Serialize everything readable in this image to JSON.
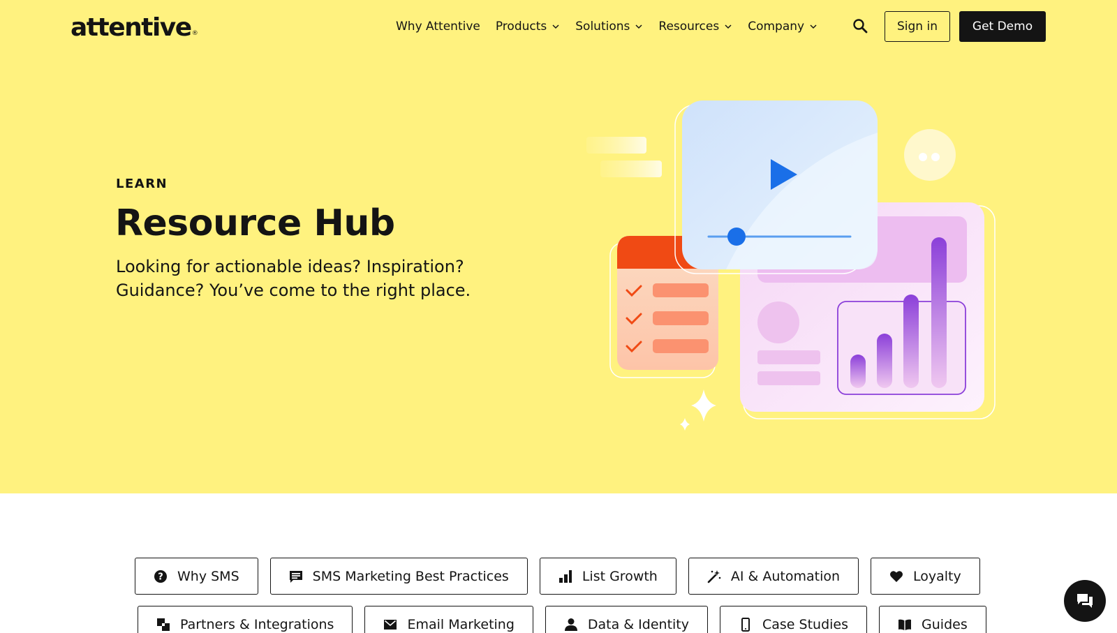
{
  "header": {
    "logo": "attentive",
    "logo_mark": "®",
    "nav": [
      {
        "label": "Why Attentive",
        "dropdown": false
      },
      {
        "label": "Products",
        "dropdown": true
      },
      {
        "label": "Solutions",
        "dropdown": true
      },
      {
        "label": "Resources",
        "dropdown": true
      },
      {
        "label": "Company",
        "dropdown": true
      }
    ],
    "search_icon": "search-icon",
    "signin_label": "Sign in",
    "demo_label": "Get Demo"
  },
  "hero": {
    "eyebrow": "LEARN",
    "title": "Resource Hub",
    "subtitle_line1": "Looking for actionable ideas? Inspiration?",
    "subtitle_line2": "Guidance? You’ve come to the right place."
  },
  "categories": {
    "row1": [
      {
        "label": "Why SMS",
        "icon": "question-circle-icon"
      },
      {
        "label": "SMS Marketing Best Practices",
        "icon": "message-icon"
      },
      {
        "label": "List Growth",
        "icon": "bar-chart-icon"
      },
      {
        "label": "AI & Automation",
        "icon": "magic-wand-icon"
      },
      {
        "label": "Loyalty",
        "icon": "heart-icon"
      }
    ],
    "row2": [
      {
        "label": "Partners & Integrations",
        "icon": "partners-icon"
      },
      {
        "label": "Email Marketing",
        "icon": "envelope-icon"
      },
      {
        "label": "Data & Identity",
        "icon": "person-icon"
      },
      {
        "label": "Case Studies",
        "icon": "phone-icon"
      },
      {
        "label": "Guides",
        "icon": "book-icon"
      }
    ]
  },
  "colors": {
    "hero_bg": "#fff27f",
    "text": "#141414",
    "accent_blue": "#1a6fe8",
    "accent_orange": "#f04a14",
    "accent_purple": "#8b3fd9"
  },
  "chat_icon": "chat-bubble-icon"
}
